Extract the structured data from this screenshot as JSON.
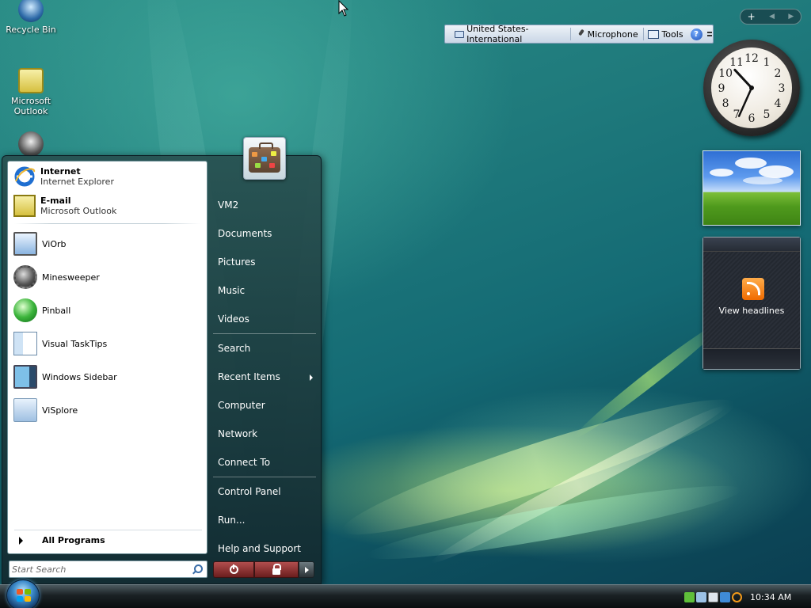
{
  "desktop": {
    "icons": [
      {
        "label": "Recycle Bin"
      },
      {
        "label": "Microsoft\nOutlook"
      }
    ]
  },
  "language_bar": {
    "language": "United States-International",
    "microphone": "Microphone",
    "tools": "Tools",
    "help": "?"
  },
  "sidebar_controls": {
    "add": "+",
    "prev": "◀",
    "next": "▶"
  },
  "clock_gadget": {
    "numbers": [
      "12",
      "1",
      "2",
      "3",
      "4",
      "5",
      "6",
      "7",
      "8",
      "9",
      "10",
      "11"
    ],
    "time": "10:34"
  },
  "feeds_gadget": {
    "label": "View headlines"
  },
  "start_menu": {
    "pinned": [
      {
        "title": "Internet",
        "subtitle": "Internet Explorer",
        "icon": "ie-icon"
      },
      {
        "title": "E-mail",
        "subtitle": "Microsoft Outlook",
        "icon": "outlook-icon"
      }
    ],
    "recent": [
      {
        "label": "ViOrb",
        "icon": "monitor-icon"
      },
      {
        "label": "Minesweeper",
        "icon": "mine-icon"
      },
      {
        "label": "Pinball",
        "icon": "pinball-icon"
      },
      {
        "label": "Visual TaskTips",
        "icon": "tasktips-icon"
      },
      {
        "label": "Windows Sidebar",
        "icon": "sidebar-icon"
      },
      {
        "label": "ViSplore",
        "icon": "visplore-icon"
      }
    ],
    "all_programs": "All Programs",
    "search_placeholder": "Start Search",
    "right_items": [
      {
        "label": "VM2"
      },
      {
        "label": "Documents"
      },
      {
        "label": "Pictures"
      },
      {
        "label": "Music"
      },
      {
        "label": "Videos"
      },
      {
        "label": "Search"
      },
      {
        "label": "Recent Items"
      },
      {
        "label": "Computer"
      },
      {
        "label": "Network"
      },
      {
        "label": "Connect To"
      },
      {
        "label": "Control Panel"
      },
      {
        "label": "Run..."
      },
      {
        "label": "Help and Support"
      }
    ]
  },
  "taskbar": {
    "time": "10:34 AM"
  },
  "colors": {
    "accent": "#1f7a7c",
    "start_menu_bg": "#1e3c40",
    "power_button": "#8b2a2a"
  }
}
